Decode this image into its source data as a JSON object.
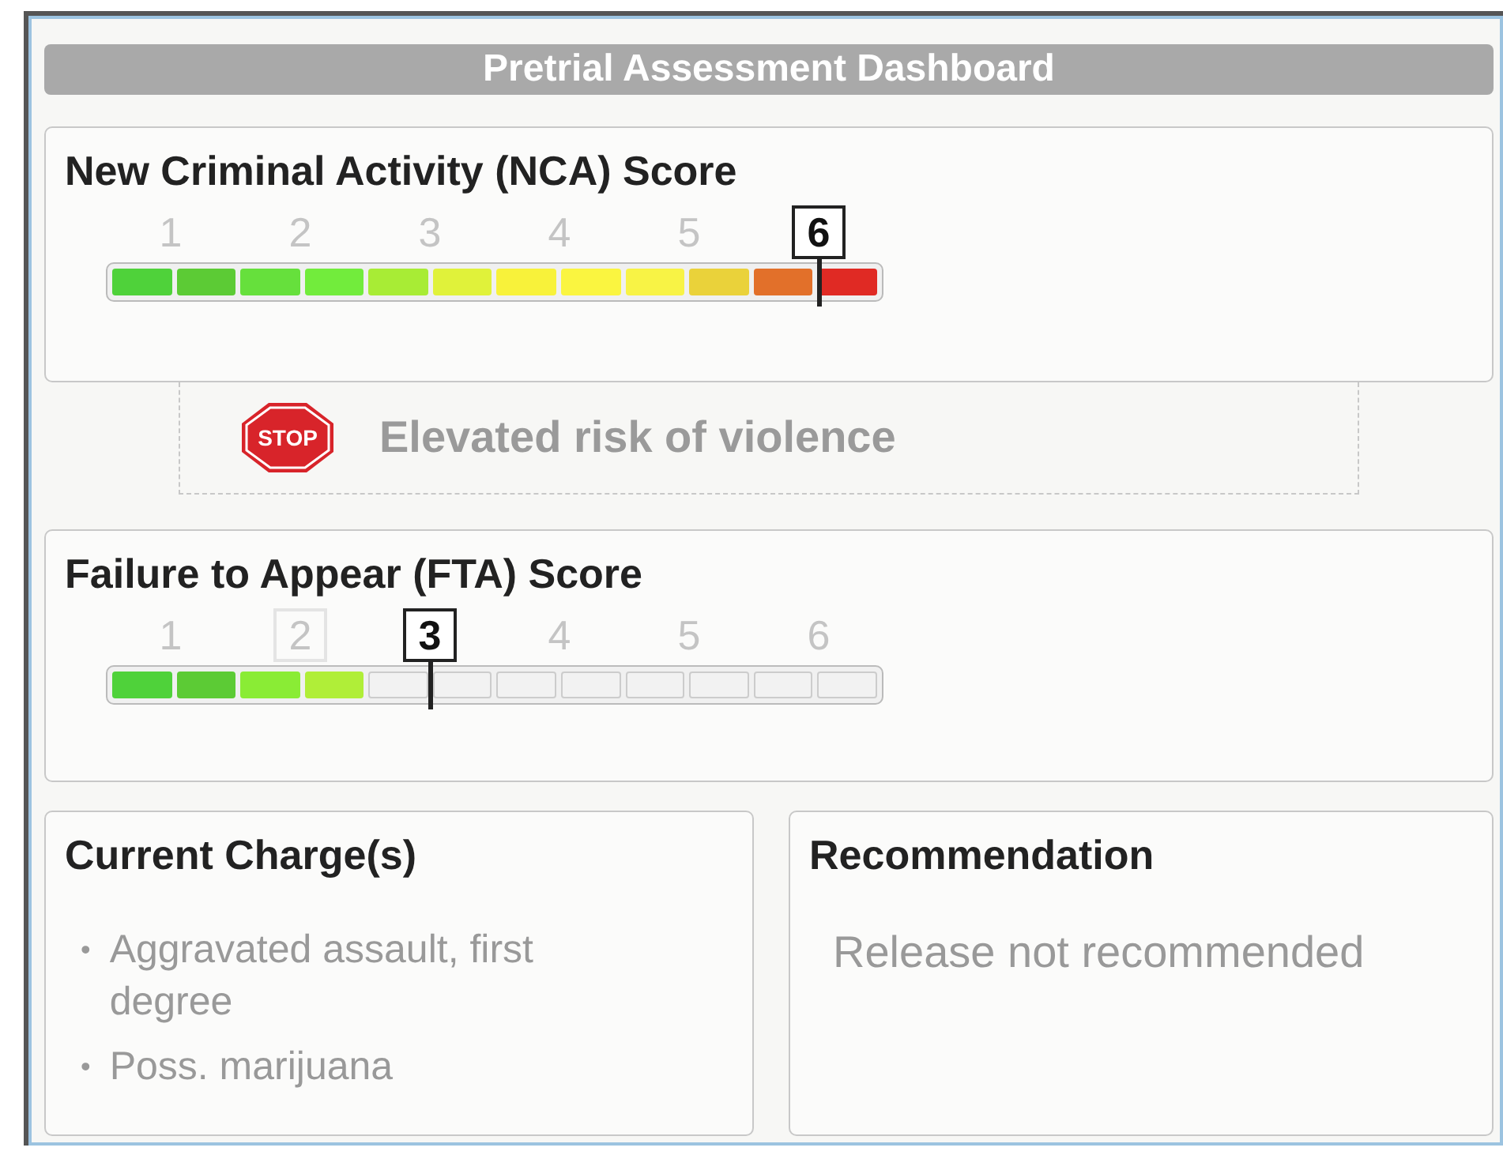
{
  "title": "Pretrial Assessment Dashboard",
  "scores": [
    {
      "title": "New Criminal Activity (NCA) Score",
      "ticks": [
        {
          "label": "1",
          "selected": false,
          "hovered": false
        },
        {
          "label": "2",
          "selected": false,
          "hovered": false
        },
        {
          "label": "3",
          "selected": false,
          "hovered": false
        },
        {
          "label": "4",
          "selected": false,
          "hovered": false
        },
        {
          "label": "5",
          "selected": false,
          "hovered": false
        },
        {
          "label": "6",
          "selected": true,
          "hovered": false
        }
      ],
      "segments": [
        {
          "filled": true,
          "color": "#4fd23a"
        },
        {
          "filled": true,
          "color": "#5ccb35"
        },
        {
          "filled": true,
          "color": "#66e03c"
        },
        {
          "filled": true,
          "color": "#72ec3c"
        },
        {
          "filled": true,
          "color": "#a8ec35"
        },
        {
          "filled": true,
          "color": "#e0f23a"
        },
        {
          "filled": true,
          "color": "#f8f23a"
        },
        {
          "filled": true,
          "color": "#faf540"
        },
        {
          "filled": true,
          "color": "#f8f345"
        },
        {
          "filled": true,
          "color": "#ead23a"
        },
        {
          "filled": true,
          "color": "#e2702a"
        },
        {
          "filled": true,
          "color": "#e02a24"
        }
      ]
    },
    {
      "title": "Failure to Appear (FTA) Score",
      "ticks": [
        {
          "label": "1",
          "selected": false,
          "hovered": false
        },
        {
          "label": "2",
          "selected": false,
          "hovered": true
        },
        {
          "label": "3",
          "selected": true,
          "hovered": false
        },
        {
          "label": "4",
          "selected": false,
          "hovered": false
        },
        {
          "label": "5",
          "selected": false,
          "hovered": false
        },
        {
          "label": "6",
          "selected": false,
          "hovered": false
        }
      ],
      "segments": [
        {
          "filled": true,
          "color": "#4fd23a"
        },
        {
          "filled": true,
          "color": "#5ccb35"
        },
        {
          "filled": true,
          "color": "#8aec35"
        },
        {
          "filled": true,
          "color": "#b0ee38"
        },
        {
          "filled": false
        },
        {
          "filled": false
        },
        {
          "filled": false
        },
        {
          "filled": false
        },
        {
          "filled": false
        },
        {
          "filled": false
        },
        {
          "filled": false
        },
        {
          "filled": false
        }
      ]
    }
  ],
  "alert": {
    "sign": "STOP",
    "text": "Elevated risk of violence"
  },
  "charges": {
    "title": "Current Charge(s)",
    "items": [
      {
        "bullet": "•",
        "text": "Aggravated assault, first degree"
      },
      {
        "bullet": "•",
        "text": "Poss. marijuana"
      }
    ]
  },
  "recommendation": {
    "title": "Recommendation",
    "text": "Release not recommended"
  }
}
